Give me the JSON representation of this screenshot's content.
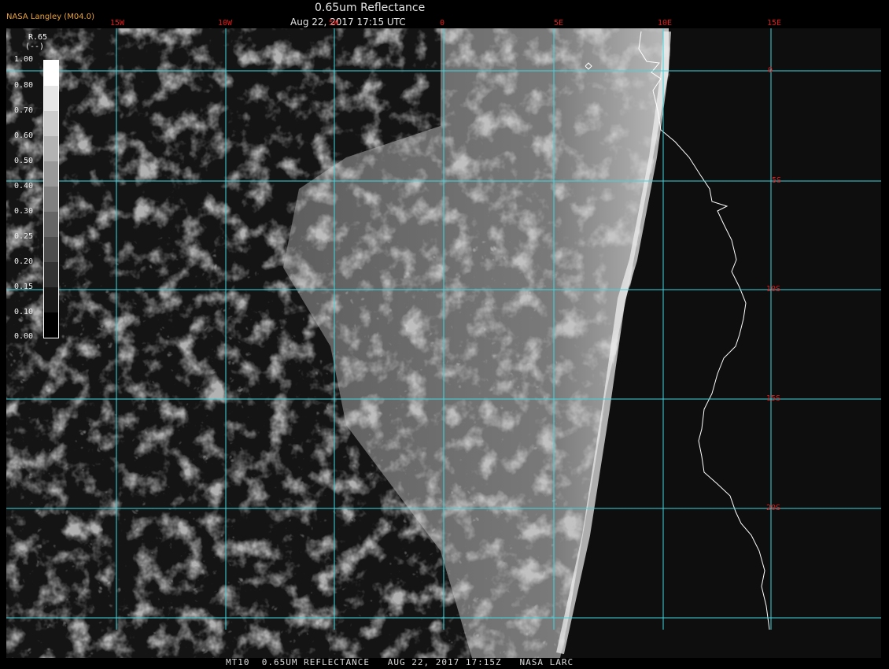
{
  "header": {
    "producer": "NASA Langley (M04.0)",
    "title": "0.65um Reflectance",
    "subtitle": "Aug 22, 2017 17:15 UTC"
  },
  "map": {
    "lon_labels": [
      "15W",
      "10W",
      "5W",
      "0",
      "5E",
      "10E",
      "15E"
    ],
    "lat_labels": [
      "0",
      "5S",
      "10S",
      "15S",
      "20S"
    ],
    "grid_color": "#3fd6e0",
    "label_color": "#e21a1a",
    "coast_color": "#ffffff"
  },
  "legend": {
    "variable": "R.65",
    "unit": "(--)",
    "ticks": [
      "1.00",
      "0.80",
      "0.70",
      "0.60",
      "0.50",
      "0.40",
      "0.30",
      "0.25",
      "0.20",
      "0.15",
      "0.10",
      "0.00"
    ]
  },
  "footer": {
    "text": "MT10  0.65UM REFLECTANCE   AUG 22, 2017 17:15Z   NASA LARC"
  }
}
